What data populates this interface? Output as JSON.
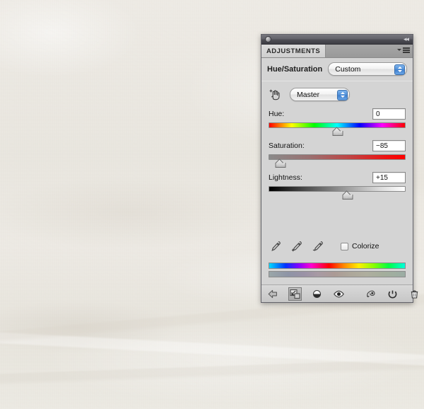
{
  "background": {
    "name": "textured-paper-backdrop",
    "color": "#ebe8e2"
  },
  "panel": {
    "titlebar": {
      "collapse_glyph": "◂◂",
      "dot_icon": "window-dot-icon"
    },
    "tab": {
      "label": "ADJUSTMENTS",
      "menu_icon": "panel-menu-icon"
    },
    "preset_row": {
      "label": "Hue/Saturation",
      "preset_value": "Custom"
    },
    "channel_row": {
      "hand_icon": "targeted-adjustment-hand-icon",
      "channel_value": "Master"
    },
    "sliders": [
      {
        "name": "hue",
        "label": "Hue:",
        "value": "0",
        "thumb_percent": 50,
        "track": "hue-rainbow-gradient"
      },
      {
        "name": "saturation",
        "label": "Saturation:",
        "value": "−85",
        "thumb_percent": 8,
        "track": "gray-to-red-gradient"
      },
      {
        "name": "lightness",
        "label": "Lightness:",
        "value": "+15",
        "thumb_percent": 57,
        "track": "black-to-white-gradient"
      }
    ],
    "tools_row": {
      "droppers": [
        {
          "name": "eyedropper-sample-icon",
          "modifier": ""
        },
        {
          "name": "eyedropper-add-icon",
          "modifier": "+"
        },
        {
          "name": "eyedropper-subtract-icon",
          "modifier": "−"
        }
      ],
      "colorize": {
        "label": "Colorize",
        "checked": false
      }
    },
    "spectra": {
      "full_bar": "hue-spectrum-full",
      "muted_bar": "hue-spectrum-adjusted"
    },
    "toolbar": {
      "items": [
        {
          "name": "return-to-adjustment-list-button",
          "icon": "left-arrow-icon"
        },
        {
          "name": "clip-to-layer-button",
          "icon": "clip-to-layer-icon",
          "selected": true
        },
        {
          "name": "toggle-layer-mask-button",
          "icon": "half-circle-icon"
        },
        {
          "name": "toggle-layer-visibility-button",
          "icon": "eye-icon"
        },
        {
          "name": "preview-previous-state-button",
          "icon": "eye-swoosh-icon"
        },
        {
          "name": "reset-adjustment-button",
          "icon": "reset-circular-arrow-icon"
        },
        {
          "name": "delete-adjustment-button",
          "icon": "trash-can-icon"
        }
      ]
    }
  }
}
